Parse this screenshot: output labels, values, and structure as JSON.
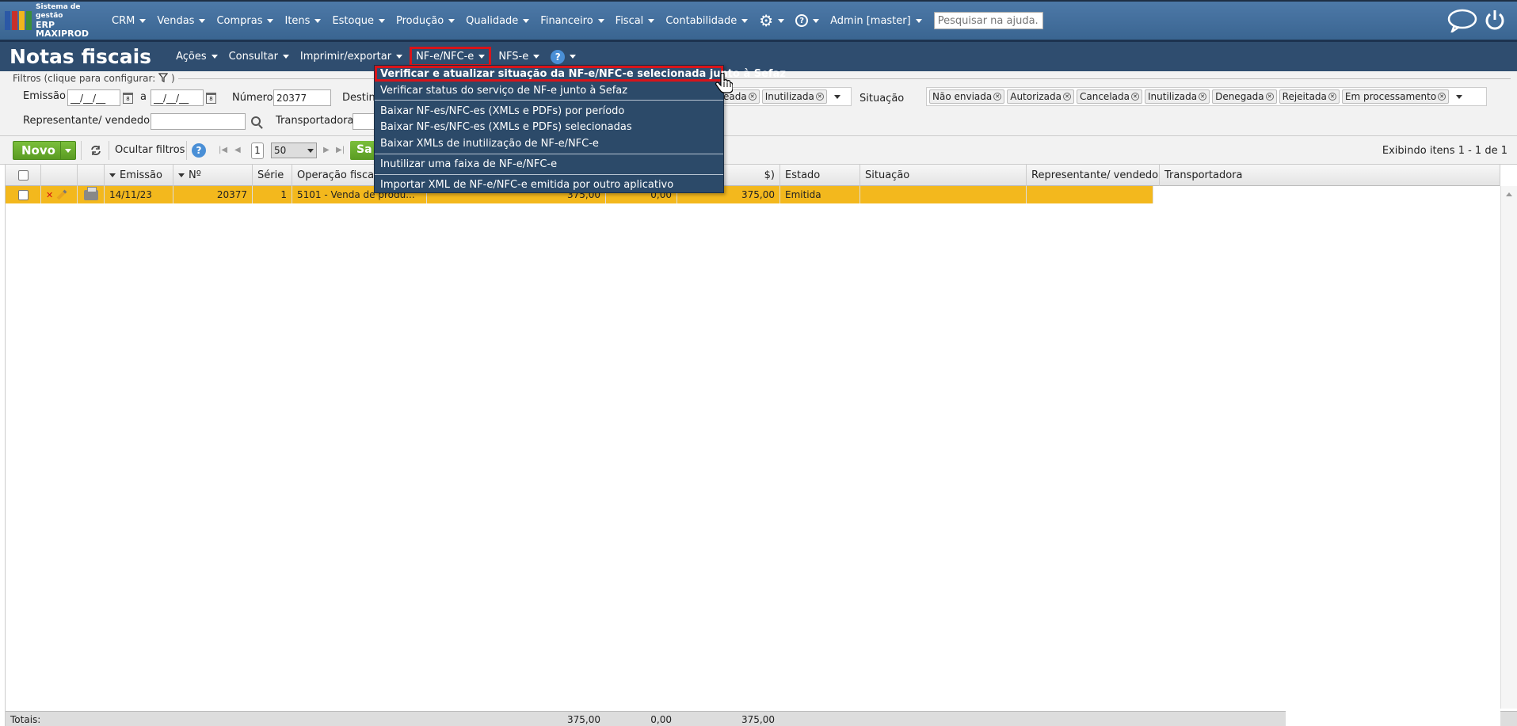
{
  "topnav": {
    "logo_line1": "Sistema de gestão",
    "logo_line2": "ERP MAXIPROD",
    "brand_colors": [
      "#2b58a6",
      "#c8302b",
      "#f1b51d",
      "#3b8f3a"
    ],
    "menus": [
      "CRM",
      "Vendas",
      "Compras",
      "Itens",
      "Estoque",
      "Produção",
      "Qualidade",
      "Financeiro",
      "Fiscal",
      "Contabilidade"
    ],
    "user": "Admin [master]",
    "help_glyph": "?",
    "search_placeholder": "Pesquisar na ajuda..."
  },
  "titlebar": {
    "title": "Notas fiscais",
    "menus": [
      "Ações",
      "Consultar",
      "Imprimir/exportar",
      "NF-e/NFC-e",
      "NFS-e"
    ],
    "help_glyph": "?"
  },
  "filters": {
    "legend": "Filtros (clique para configurar:",
    "legend_close": ")",
    "emissao_label": "Emissão",
    "date_from": "__/__/__",
    "date_sep": "a",
    "date_to": "__/__/__",
    "numero_label": "Número",
    "numero_value": "20377",
    "destinatario_label": "Destin",
    "estado_tags_visible": [
      "eada",
      "Inutilizada"
    ],
    "situacao_label": "Situação",
    "situacao_tags": [
      "Não enviada",
      "Autorizada",
      "Cancelada",
      "Inutilizada",
      "Denegada",
      "Rejeitada",
      "Em processamento"
    ],
    "representante_label": "Representante/ vendedor",
    "transportadora_label": "Transportadora"
  },
  "toolbar": {
    "novo_label": "Novo",
    "ocultar_label": "Ocultar filtros",
    "page_current": "1",
    "page_size": "50",
    "save_partial": "Sa",
    "items_info": "Exibindo itens 1 - 1 de 1"
  },
  "grid": {
    "headers": {
      "emissao": "Emissão",
      "numero": "Nº",
      "serie": "Série",
      "operacao": "Operação fiscal",
      "valor_partial": "$)",
      "estado": "Estado",
      "situacao": "Situação",
      "representante": "Representante/ vendedor",
      "transportadora": "Transportadora"
    },
    "row": {
      "emissao": "14/11/23",
      "numero": "20377",
      "serie": "1",
      "operacao": "5101 - Venda de produ...",
      "val1": "375,00",
      "val2": "0,00",
      "val3": "375,00",
      "estado": "Emitida",
      "situacao": "",
      "representante": ""
    },
    "totals": {
      "label": "Totais:",
      "val1": "375,00",
      "val2": "0,00",
      "val3": "375,00"
    },
    "row_color": "#f3b81d"
  },
  "dropdown": {
    "items": [
      "Verificar e atualizar situação da NF-e/NFC-e selecionada junto à Sefaz",
      "Verificar status do serviço de NF-e junto à Sefaz",
      "Baixar NF-es/NFC-es (XMLs e PDFs) por período",
      "Baixar NF-es/NFC-es (XMLs e PDFs) selecionadas",
      "Baixar XMLs de inutilização de NF-e/NFC-e",
      "Inutilizar uma faixa de NF-e/NFC-e",
      "Importar XML de NF-e/NFC-e emitida por outro aplicativo"
    ],
    "highlight_color": "#d8141a"
  }
}
